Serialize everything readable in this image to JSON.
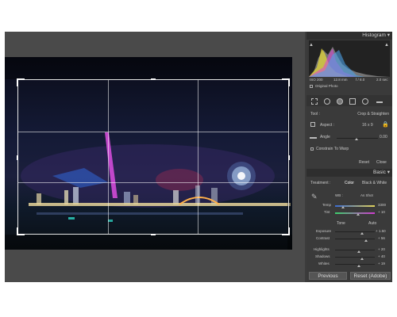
{
  "histogram": {
    "title": "Histogram",
    "meta": [
      "ISO 200",
      "12.8 mm",
      "f / 8.0",
      "2.0 sec"
    ],
    "original_photo": "Original Photo"
  },
  "crop": {
    "tool_label": "Tool :",
    "tool_value": "Crop & Straighten",
    "aspect_label": "Aspect :",
    "aspect_value": "16 x 9",
    "angle_label": "Angle",
    "angle_value": "0.00",
    "constrain_label": "Constrain To Warp",
    "reset_label": "Reset",
    "close_label": "Close"
  },
  "basic": {
    "title": "Basic",
    "treatment_label": "Treatment :",
    "treatment_color": "Color",
    "treatment_bw": "Black & White",
    "wb_label": "WB :",
    "wb_value": "As Shot",
    "temp_label": "Temp",
    "temp_value": "3300",
    "tint_label": "Tint",
    "tint_value": "+ 10",
    "tone_label": "Tone",
    "auto_label": "Auto",
    "exposure_label": "Exposure",
    "exposure_value": "+ 1.50",
    "contrast_label": "Contrast",
    "contrast_value": "+ 56",
    "highlights_label": "Highlights",
    "highlights_value": "+ 20",
    "shadows_label": "Shadows",
    "shadows_value": "+ 40",
    "whites_label": "Whites",
    "whites_value": "+ 19"
  },
  "footer": {
    "previous_label": "Previous",
    "reset_label": "Reset (Adobe)"
  }
}
